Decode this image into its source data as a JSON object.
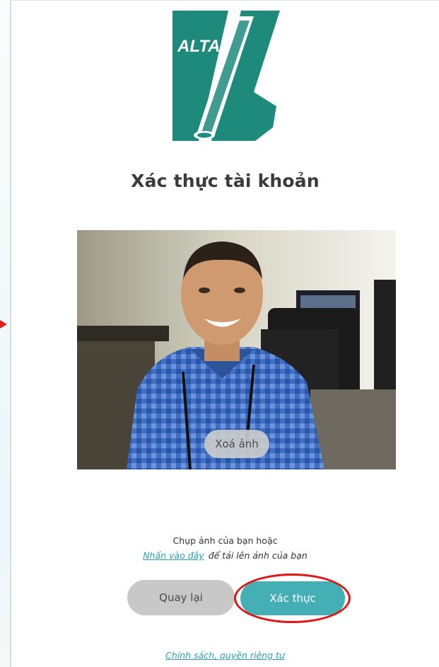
{
  "logo": {
    "text": "ALTA",
    "brand_color": "#1e8a7c"
  },
  "page_title": "Xác thực tài khoản",
  "photo": {
    "delete_label": "Xoá ảnh"
  },
  "helper": {
    "line1": "Chụp ảnh của bạn hoặc",
    "upload_link": "Nhấn vào đây",
    "line2_rest": "để tải lên ảnh của bạn"
  },
  "actions": {
    "back_label": "Quay lại",
    "verify_label": "Xác thực",
    "verify_color": "#44b0b6"
  },
  "footer": {
    "privacy_link": "Chính sách, quyền riêng tư"
  },
  "annotation_color": "#e01616"
}
